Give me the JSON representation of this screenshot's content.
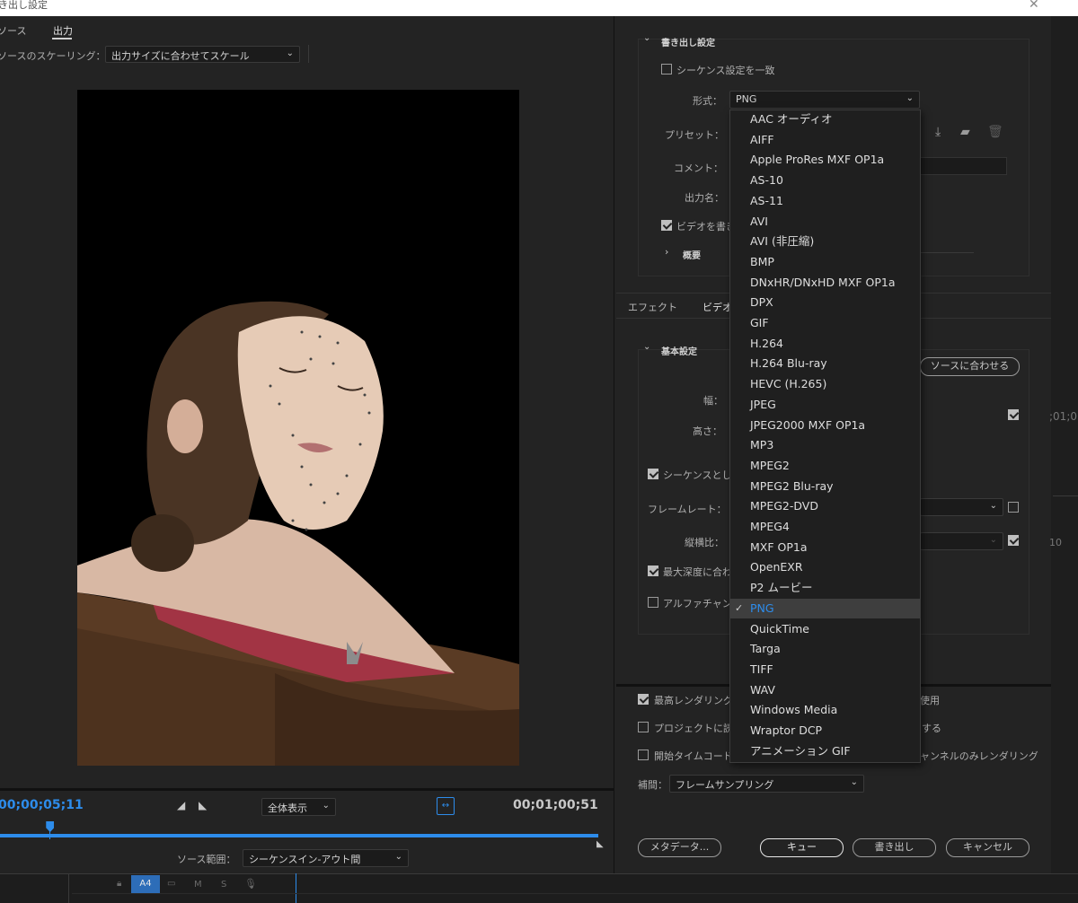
{
  "window": {
    "title": "き出し設定"
  },
  "left": {
    "tabs": [
      {
        "label": "ソース"
      },
      {
        "label": "出力"
      }
    ],
    "scaling_label": "ソースのスケーリング：",
    "scaling_value": "出力サイズに合わせてスケール",
    "current_time": "00;00;05;11",
    "zoom_value": "全体表示",
    "duration": "00;01;00;51",
    "source_range_label": "ソース範囲：",
    "source_range_value": "シーケンスイン-アウト間",
    "playhead_fraction": 0.083
  },
  "track": {
    "name": "A4",
    "m": "M",
    "s": "S"
  },
  "export": {
    "header": "書き出し設定",
    "match_sequence": "シーケンス設定を一致",
    "format_label": "形式：",
    "format_value": "PNG",
    "preset_label": "プリセット：",
    "comment_label": "コメント：",
    "output_name_label": "出力名：",
    "export_video": "ビデオを書き",
    "summary": "概要"
  },
  "tabs2": [
    {
      "label": "エフェクト"
    },
    {
      "label": "ビデオ"
    }
  ],
  "basic": {
    "header": "基本設定",
    "match_source_button": "ソースに合わせる",
    "width_label": "幅：",
    "height_label": "高さ：",
    "render_as_sequence": "シーケンスとし",
    "frame_rate_label": "フレームレート：",
    "aspect_label": "縦横比：",
    "max_depth": "最大深度に合わ",
    "alpha_channel": "アルファチャン"
  },
  "bottom": {
    "max_render_quality": "最高レンダリング",
    "max_render_quality_tail": "使用",
    "project_import": "プロジェクトに読",
    "project_import_tail": "する",
    "start_timecode": "開始タイムコード",
    "render_alpha_tail": "ャンネルのみレンダリング",
    "interp_label": "補間：",
    "interp_value": "フレームサンプリング",
    "buttons": {
      "metadata": "メタデータ...",
      "queue": "キュー",
      "export": "書き出し",
      "cancel": "キャンセル"
    }
  },
  "side_partial": {
    "tc": ";01;0",
    "ten": "10"
  },
  "formats": [
    "AAC オーディオ",
    "AIFF",
    "Apple ProRes MXF OP1a",
    "AS-10",
    "AS-11",
    "AVI",
    "AVI (非圧縮)",
    "BMP",
    "DNxHR/DNxHD MXF OP1a",
    "DPX",
    "GIF",
    "H.264",
    "H.264 Blu-ray",
    "HEVC (H.265)",
    "JPEG",
    "JPEG2000 MXF OP1a",
    "MP3",
    "MPEG2",
    "MPEG2 Blu-ray",
    "MPEG2-DVD",
    "MPEG4",
    "MXF OP1a",
    "OpenEXR",
    "P2 ムービー",
    "PNG",
    "QuickTime",
    "Targa",
    "TIFF",
    "WAV",
    "Windows Media",
    "Wraptor DCP",
    "アニメーション GIF"
  ],
  "selected_format_index": 24,
  "colors": {
    "accent": "#2d8ceb",
    "panel": "#232323",
    "dropdown": "#1f1f1f"
  },
  "icons": [
    "chevron-down-icon",
    "download-preset-icon",
    "import-preset-icon",
    "trash-icon",
    "check-icon",
    "fit-icon",
    "lock-icon",
    "camera-icon",
    "mic-icon"
  ]
}
